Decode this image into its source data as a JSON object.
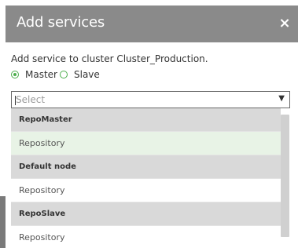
{
  "dialog": {
    "title": "Add services",
    "close_label": "×",
    "description": "Add service to cluster Cluster_Production."
  },
  "role_options": [
    {
      "label": "Master",
      "checked": true
    },
    {
      "label": "Slave",
      "checked": false
    }
  ],
  "service_select": {
    "placeholder": "Select",
    "arrow": "▼"
  },
  "dropdown": {
    "groups": [
      {
        "label": "RepoMaster",
        "options": [
          {
            "label": "Repository",
            "highlighted": true
          }
        ]
      },
      {
        "label": "Default node",
        "options": [
          {
            "label": "Repository",
            "highlighted": false
          }
        ]
      },
      {
        "label": "RepoSlave",
        "options": [
          {
            "label": "Repository",
            "highlighted": false
          }
        ]
      }
    ]
  },
  "colors": {
    "header_bg": "#8a8a8a",
    "radio_accent": "#4cae4c",
    "group_row_bg": "#d9d9d9",
    "highlight_row_bg": "#e8f3e6"
  }
}
